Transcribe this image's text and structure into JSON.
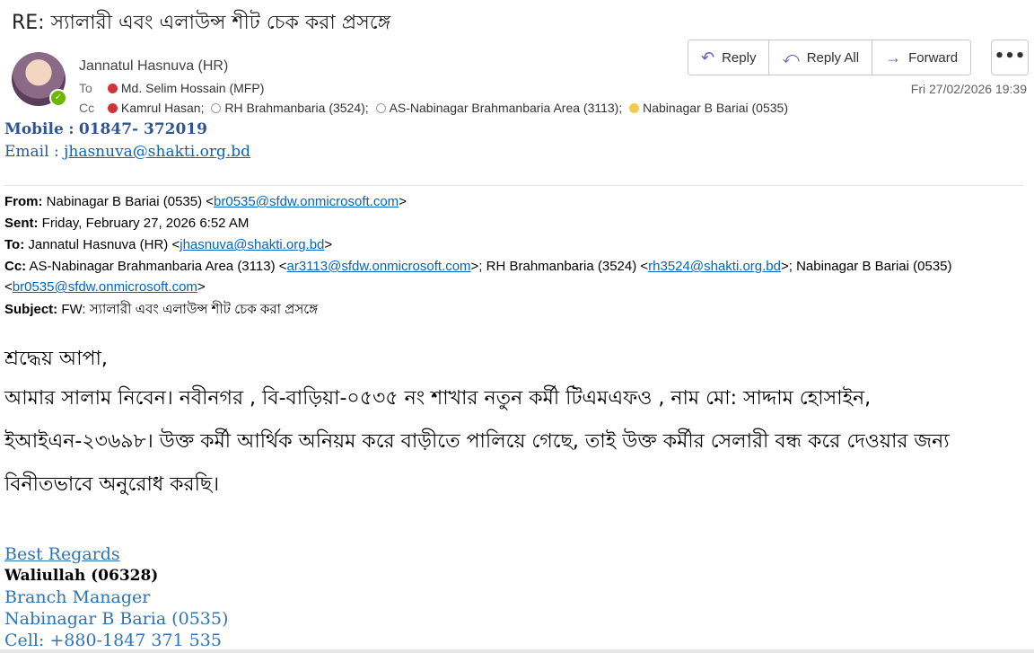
{
  "subject": "RE: স্যালারী এবং এলাউন্স শীট চেক করা প্রসঙ্গে",
  "sender": {
    "name": "Jannatul Hasnuva (HR)"
  },
  "to": {
    "label": "To",
    "recipients": [
      "Md. Selim Hossain (MFP)"
    ]
  },
  "cc": {
    "label": "Cc",
    "recipients": [
      "Kamrul Hasan;",
      "RH Brahmanbaria (3524);",
      "AS-Nabinagar Brahmanbaria Area (3113);",
      "Nabinagar B Bariai (0535)"
    ]
  },
  "toolbar": {
    "reply": "Reply",
    "reply_all": "Reply All",
    "forward": "Forward",
    "more": "•••"
  },
  "date": "Fri 27/02/2026 19:39",
  "contact": {
    "mobile_label": "Mobile",
    "mobile": "01847- 372019",
    "email_label": "Email",
    "email": "jhasnuva@shakti.org.bd"
  },
  "forwarded": {
    "from_label": "From:",
    "from_name": "Nabinagar B Bariai (0535) <",
    "from_email": "br0535@sfdw.onmicrosoft.com",
    "sent_label": "Sent:",
    "sent": "Friday, February 27, 2026 6:52 AM",
    "to_label": "To:",
    "to_name": "Jannatul Hasnuva (HR) <",
    "to_email": "jhasnuva@shakti.org.bd",
    "cc_label": "Cc:",
    "cc1_name": "AS-Nabinagar Brahmanbaria Area (3113) <",
    "cc1_email": "ar3113@sfdw.onmicrosoft.com",
    "cc2_name": ">; RH Brahmanbaria (3524) <",
    "cc2_email": "rh3524@shakti.org.bd",
    "cc3_name": ">; Nabinagar B Bariai (0535) <",
    "cc3_email": "br0535@sfdw.onmicrosoft.com",
    "subject_label": "Subject:",
    "subject": "FW: স্যালারী এবং এলাউন্স শীট চেক করা প্রসঙ্গে"
  },
  "body": {
    "greeting": "শ্রদ্ধেয় আপা,",
    "paragraph": "আমার সালাম নিবেন। নবীনগর , বি-বাড়িয়া-০৫৩৫ নং শাখার নতুন কর্মী টিএমএফও , নাম মো: সাদ্দাম হোসাইন, ইআইএন-২৩৬৯৮। উক্ত কর্মী আর্থিক অনিয়ম করে বাড়ীতে পালিয়ে গেছে, তাই উক্ত কর্মীর সেলারী বন্ধ করে দেওয়ার জন্য বিনীতভাবে অনুরোধ করছি।"
  },
  "signature": {
    "regards": "Best Regards",
    "name": "Waliullah (06328)",
    "title": "Branch Manager",
    "branch": "Nabinagar B Baria (0535)",
    "cell": "Cell: +880-1847 371 535"
  }
}
